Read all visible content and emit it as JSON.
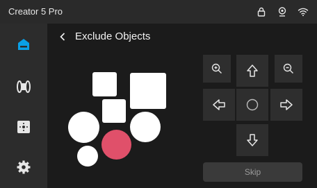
{
  "app": {
    "title": "Creator 5 Pro"
  },
  "status_icons": [
    "lock-icon",
    "webcam-icon",
    "wifi-icon"
  ],
  "sidebar": {
    "items": [
      "home-icon",
      "filament-icon",
      "calibration-icon",
      "settings-icon"
    ],
    "active": "home-icon"
  },
  "page": {
    "title": "Exclude Objects"
  },
  "controls": {
    "skip_label": "Skip"
  },
  "colors": {
    "accent": "#0aa0e6",
    "selected_object": "#e0506a",
    "object": "#ffffff"
  }
}
